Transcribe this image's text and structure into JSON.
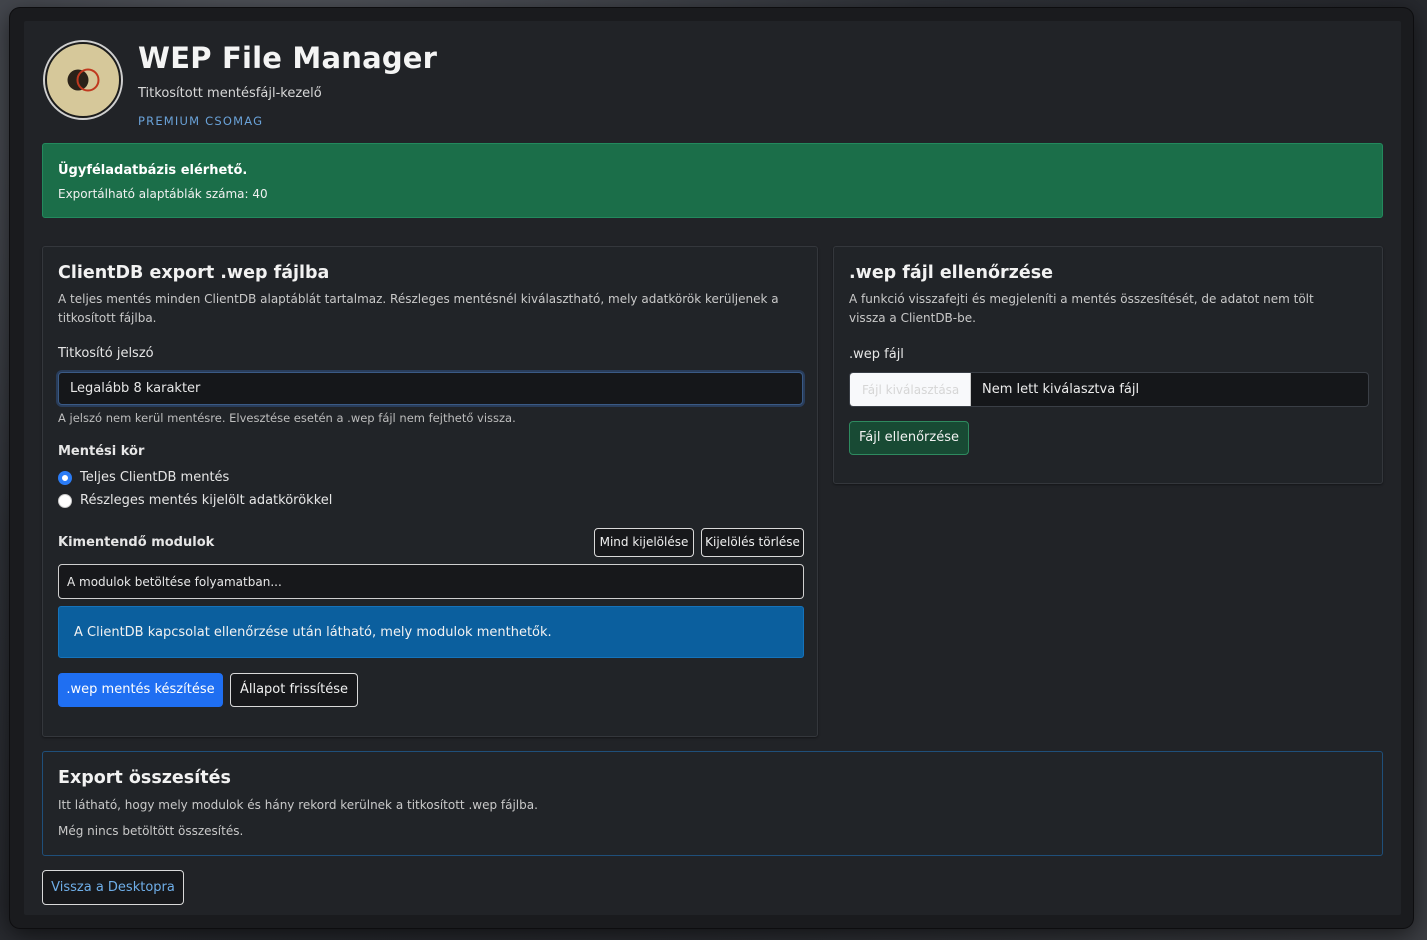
{
  "header": {
    "title": "WEP File Manager",
    "subtitle": "Titkosított mentésfájl-kezelő",
    "badge": "PREMIUM CSOMAG"
  },
  "status": {
    "heading": "Ügyféladatbázis elérhető.",
    "text": "Exportálható alaptáblák száma: 40"
  },
  "export": {
    "title": "ClientDB export .wep fájlba",
    "description": "A teljes mentés minden ClientDB alaptáblát tartalmaz. Részleges mentésnél kiválasztható, mely adatkörök kerüljenek a titkosított fájlba.",
    "password_label": "Titkosító jelszó",
    "password_placeholder": "Legalább 8 karakter",
    "password_hint": "A jelszó nem kerül mentésre. Elvesztése esetén a .wep fájl nem fejthető vissza.",
    "scope_label": "Mentési kör",
    "scope_options": [
      {
        "label": "Teljes ClientDB mentés",
        "selected": true
      },
      {
        "label": "Részleges mentés kijelölt adatkörökkel",
        "selected": false
      }
    ],
    "modules_label": "Kimentendő modulok",
    "select_all": "Mind kijelölése",
    "clear_selection": "Kijelölés törlése",
    "modules_loading": "A modulok betöltése folyamatban...",
    "modules_info": "A ClientDB kapcsolat ellenőrzése után látható, mely modulok menthetők.",
    "create_button": ".wep mentés készítése",
    "refresh_button": "Állapot frissítése"
  },
  "verify": {
    "title": ".wep fájl ellenőrzése",
    "description": "A funkció visszafejti és megjeleníti a mentés összesítését, de adatot nem tölt vissza a ClientDB-be.",
    "file_label": ".wep fájl",
    "file_button": "Fájl kiválasztása",
    "file_status": "Nem lett kiválasztva fájl",
    "check_button": "Fájl ellenőrzése"
  },
  "summary": {
    "title": "Export összesítés",
    "description": "Itt látható, hogy mely modulok és hány rekord kerülnek a titkosított .wep fájlba.",
    "empty": "Még nincs betöltött összesítés."
  },
  "footer": {
    "back_button": "Vissza a Desktopra"
  },
  "colors": {
    "success": "#1b6e49",
    "primary": "#1f6ff2",
    "info": "#0b5f9e",
    "badge": "#6aa2d8"
  }
}
